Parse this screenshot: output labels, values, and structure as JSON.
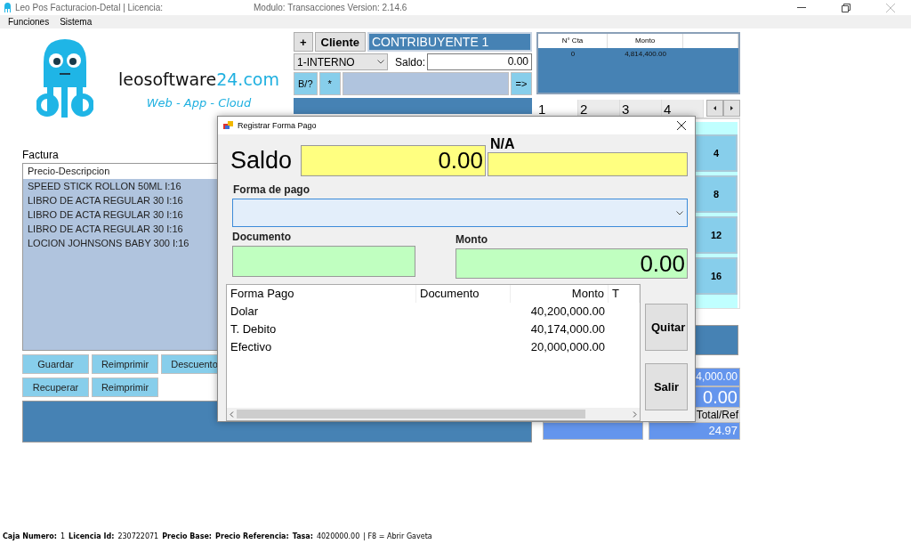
{
  "window": {
    "title": "Leo Pos Facturacion-Detal | Licencia:",
    "module": "Modulo: Transacciones Version:  2.14.6"
  },
  "menu": [
    "Funciones",
    "Sistema"
  ],
  "logo": {
    "name": "leosoftware",
    "name_accent": "24.com",
    "tagline": "Web - App - Cloud"
  },
  "customer": {
    "add_button": "+",
    "client_button": "Cliente",
    "client_name": "CONTRIBUYENTE 1",
    "client_type": "1-INTERNO",
    "balance_label": "Saldo:",
    "balance": "0.00",
    "b_button": "B/?",
    "star_button": "*",
    "go_button": "=>"
  },
  "invoice": {
    "title": "Factura",
    "header": "Precio-Descripcion",
    "items": [
      "SPEED STICK ROLLON 50ML I:16",
      "LIBRO DE ACTA REGULAR 30 I:16",
      "LIBRO DE ACTA REGULAR 30 I:16",
      "LIBRO DE ACTA REGULAR 30 I:16",
      "LOCION JOHNSONS BABY 300 I:16"
    ],
    "buttons_row_1": [
      "Guardar",
      "Reimprimir",
      "Descuento"
    ],
    "buttons_row_2": [
      "Recuperar",
      "Reimprimir"
    ]
  },
  "accounts": {
    "columns": [
      "N° Cta",
      "Monto"
    ],
    "rows": [
      [
        "0",
        "4,814,400.00"
      ]
    ]
  },
  "tabs": [
    {
      "label": "1",
      "selected": true
    },
    {
      "label": "2",
      "selected": false
    },
    {
      "label": "3",
      "selected": false
    },
    {
      "label": "4",
      "selected": false
    }
  ],
  "quick_buttons": [
    "4",
    "8",
    "12",
    "16"
  ],
  "totals": {
    "amount": "4,000.00",
    "balance": "0.00",
    "ref_label": "Total/Ref",
    "ref": "24.97"
  },
  "dialog": {
    "title": "Registrar Forma Pago",
    "balance_label": "Saldo",
    "balance": "0.00",
    "na_label": "N/A",
    "method_label": "Forma de pago",
    "document_label": "Documento",
    "amount_label": "Monto",
    "amount": "0.00",
    "columns": [
      "Forma Pago",
      "Documento",
      "Monto",
      "T"
    ],
    "rows": [
      [
        "Dolar",
        "",
        "40,200,000.00"
      ],
      [
        "T. Debito",
        "",
        "40,174,000.00"
      ],
      [
        "Efectivo",
        "",
        "20,000,000.00"
      ]
    ],
    "buttons": [
      "Quitar",
      "Salir"
    ]
  },
  "status_bar": [
    {
      "label": "Caja Numero:",
      "value": "1"
    },
    {
      "label": "Licencia Id:",
      "value": "230722071"
    },
    {
      "label": "Precio Base:"
    },
    {
      "label": "Precio Referencia:"
    },
    {
      "label": "Tasa:",
      "value": "4020000.00"
    },
    {
      "text": "| F8 = Abrir Gaveta"
    }
  ]
}
